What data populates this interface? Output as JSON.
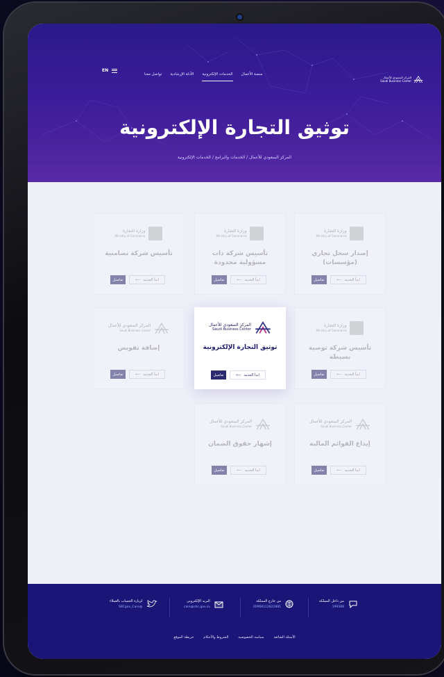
{
  "header": {
    "lang": "EN",
    "nav": [
      {
        "label": "منصة الأعمال",
        "active": false
      },
      {
        "label": "الخدمات الإلكترونية",
        "active": true
      },
      {
        "label": "الأدلة الإرشادية",
        "active": false
      },
      {
        "label": "تواصل معنا",
        "active": false
      }
    ],
    "logo_ar": "المركز السعودي للأعمال",
    "logo_en": "Saudi Business Center"
  },
  "hero": {
    "title": "توثيق التجارة الإلكترونية",
    "breadcrumb": "المركز السعودي للأعمال / الخدمات والبرامج / الخدمات الإلكترونية"
  },
  "cards": [
    {
      "logo_ar": "وزارة التجارة",
      "logo_en": "Ministry of Commerce",
      "title": "إصدار سجل تجاري (مؤسسات)",
      "start": "ابدأ الخدمة",
      "details": "تفاصيل"
    },
    {
      "logo_ar": "وزارة التجارة",
      "logo_en": "Ministry of Commerce",
      "title": "تأسيس شركة ذات مسؤولية محدودة",
      "start": "ابدأ الخدمة",
      "details": "تفاصيل"
    },
    {
      "logo_ar": "وزارة التجارة",
      "logo_en": "Ministry of Commerce",
      "title": "تأسيس شركة تضامنية",
      "start": "ابدأ الخدمة",
      "details": "تفاصيل"
    },
    {
      "logo_ar": "وزارة التجارة",
      "logo_en": "Ministry of Commerce",
      "title": "تأسيس شركة توصية بسيطة",
      "start": "ابدأ الخدمة",
      "details": "تفاصيل"
    },
    {
      "logo_ar": "المركز السعودي للأعمال",
      "logo_en": "Saudi Business Center",
      "title": "توثيق التجارة الإلكترونية",
      "start": "ابدأ الخدمة",
      "details": "تفاصيل"
    },
    {
      "logo_ar": "المركز السعودي للأعمال",
      "logo_en": "Saudi Business Center",
      "title": "إضافة تفويض",
      "start": "ابدأ الخدمة",
      "details": "تفاصيل"
    },
    {
      "logo_ar": "المركز السعودي للأعمال",
      "logo_en": "Saudi Business Center",
      "title": "إيداع القوائم المالية",
      "start": "ابدأ الخدمة",
      "details": "تفاصيل"
    },
    {
      "logo_ar": "المركز السعودي للأعمال",
      "logo_en": "Saudi Business Center",
      "title": "إشهار حقوق الضمان",
      "start": "ابدأ الخدمة",
      "details": "تفاصيل"
    }
  ],
  "footer": {
    "inside_label": "من داخل المملكة",
    "inside_value": "199388",
    "outside_label": "من خارج المملكة",
    "outside_value": "00966112822881",
    "email_label": "البريد الإلكتروني",
    "email_value": "care@sbc.gov.sa",
    "social_label": "لزيارة الحساب بالعملاء",
    "social_value": "@SBCgov_Care",
    "links": [
      "الأسئلة الشائعة",
      "سياسة الخصوصية",
      "الشروط والأحكام",
      "خريطة الموقع"
    ]
  }
}
